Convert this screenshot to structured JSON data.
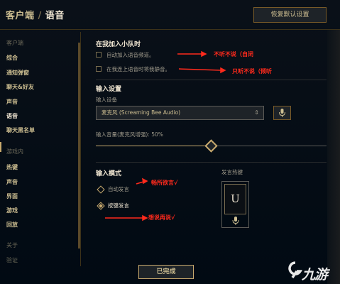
{
  "header": {
    "crumb_root": "客户端",
    "crumb_sep": "/",
    "crumb_current": "语音",
    "restore_label": "恢复默认设置"
  },
  "sidebar": {
    "client_head": "客户端",
    "client_items": [
      {
        "label": "综合"
      },
      {
        "label": "通知弹窗"
      },
      {
        "label": "聊天&好友"
      },
      {
        "label": "声音"
      },
      {
        "label": "语音"
      },
      {
        "label": "聊天黑名单"
      }
    ],
    "game_head": "游戏内",
    "game_items": [
      {
        "label": "热键"
      },
      {
        "label": "声音"
      },
      {
        "label": "界面"
      },
      {
        "label": "游戏"
      },
      {
        "label": "回放"
      }
    ],
    "about_head": "关于",
    "about_items": [
      {
        "label": "验证"
      }
    ]
  },
  "party": {
    "title": "在我加入小队时",
    "options": [
      {
        "label": "自动加入语音频道。",
        "checked": false
      },
      {
        "label": "在我连上语音时将我静音。",
        "checked": false
      }
    ]
  },
  "input": {
    "title": "输入设置",
    "device_label": "输入设备",
    "device_value": "麦克风 (Screaming Bee Audio)",
    "volume_label": "输入音量(麦克风增强): 50%",
    "volume_percent": 50
  },
  "mode": {
    "title": "输入模式",
    "options": [
      {
        "label": "自动发言",
        "selected": false
      },
      {
        "label": "按键发言",
        "selected": true
      }
    ],
    "hotkey_title": "发言热键",
    "hotkey_key": "U"
  },
  "footer": {
    "done_label": "已完成"
  },
  "annotations": [
    {
      "text": "不听不说（自闭"
    },
    {
      "text": "只听不说（倾听"
    },
    {
      "text": "畅所欲言√"
    },
    {
      "text": "想说再说√"
    }
  ],
  "watermark": {
    "text": "九游"
  },
  "colors": {
    "gold": "#c8aa6e",
    "text_light": "#f0e6d2",
    "annotation_red": "#ff2a1c",
    "background": "#010a13"
  }
}
